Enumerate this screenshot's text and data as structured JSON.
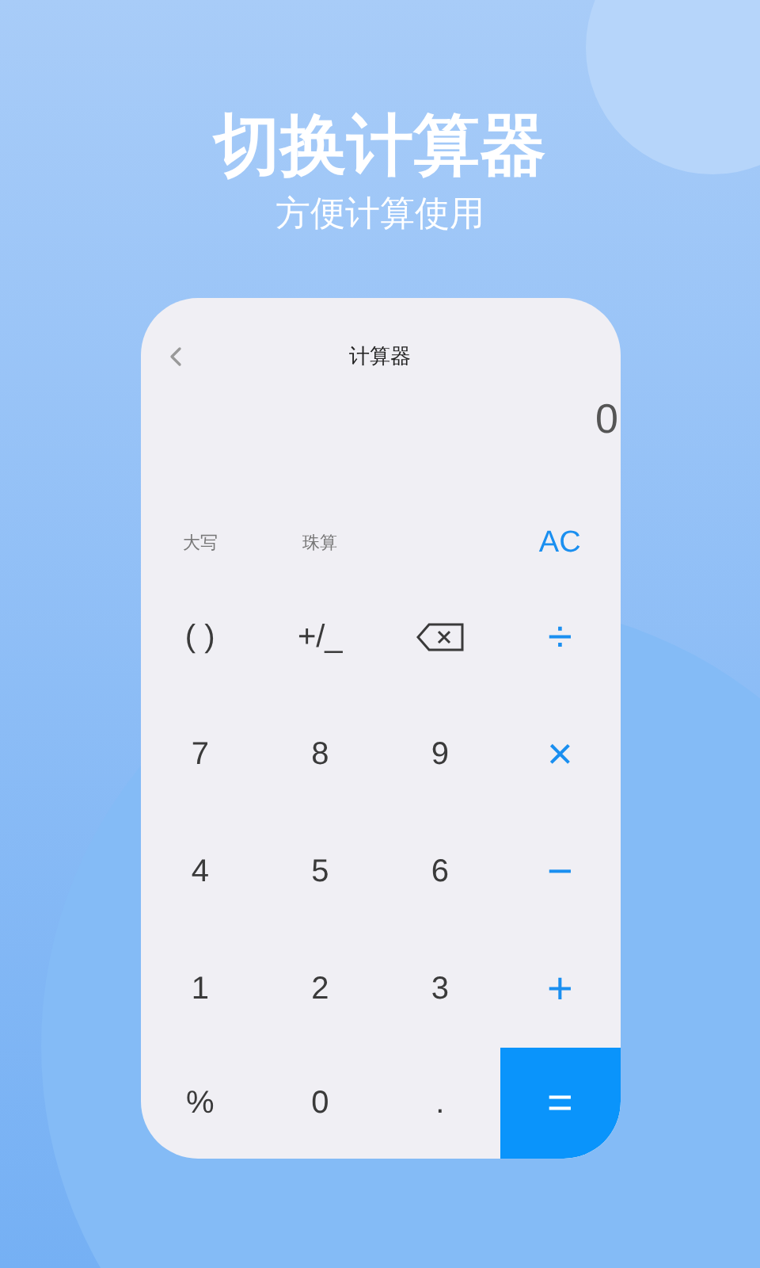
{
  "headline": "切换计算器",
  "tagline": "方便计算使用",
  "calculator": {
    "title": "计算器",
    "display": "0",
    "function_keys": [
      {
        "label": "大写",
        "kind": "mode"
      },
      {
        "label": "珠算",
        "kind": "mode"
      },
      {
        "label": "AC",
        "kind": "clear"
      }
    ],
    "key_rows": [
      [
        {
          "label": "( )",
          "kind": "digit"
        },
        {
          "label": "+/_",
          "kind": "digit"
        },
        {
          "kind": "backspace"
        },
        {
          "label": "÷",
          "kind": "op"
        }
      ],
      [
        {
          "label": "7",
          "kind": "digit"
        },
        {
          "label": "8",
          "kind": "digit"
        },
        {
          "label": "9",
          "kind": "digit"
        },
        {
          "label": "×",
          "kind": "op"
        }
      ],
      [
        {
          "label": "4",
          "kind": "digit"
        },
        {
          "label": "5",
          "kind": "digit"
        },
        {
          "label": "6",
          "kind": "digit"
        },
        {
          "label": "−",
          "kind": "op"
        }
      ],
      [
        {
          "label": "1",
          "kind": "digit"
        },
        {
          "label": "2",
          "kind": "digit"
        },
        {
          "label": "3",
          "kind": "digit"
        },
        {
          "label": "+",
          "kind": "op"
        }
      ],
      [
        {
          "label": "%",
          "kind": "digit"
        },
        {
          "label": "0",
          "kind": "digit"
        },
        {
          "label": ".",
          "kind": "digit"
        },
        {
          "label": "=",
          "kind": "equals"
        }
      ]
    ]
  }
}
